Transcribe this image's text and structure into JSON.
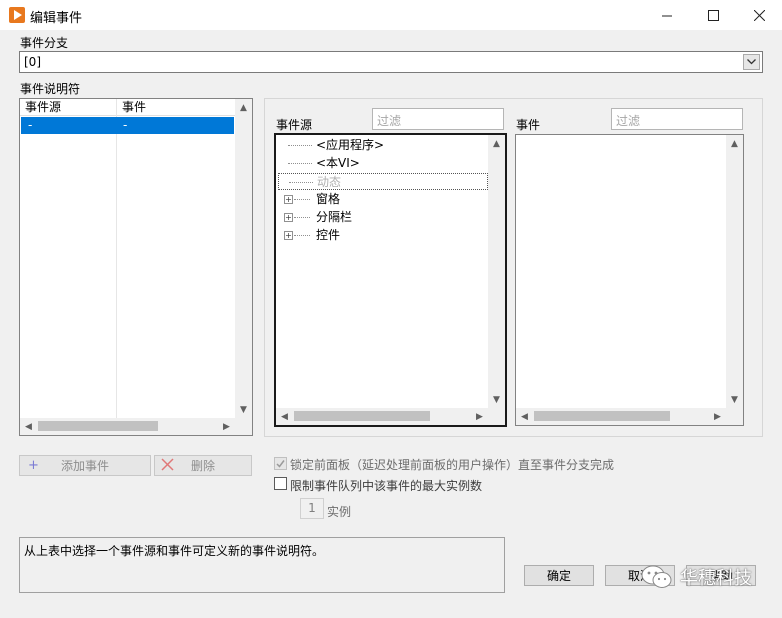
{
  "window": {
    "title": "编辑事件",
    "minimize_icon": "minimize-icon",
    "maximize_icon": "maximize-icon",
    "close_icon": "close-icon"
  },
  "event_case": {
    "label": "事件分支",
    "value": "[0]"
  },
  "specifiers": {
    "label": "事件说明符",
    "columns": [
      "事件源",
      "事件"
    ],
    "rows": [
      {
        "source": "-",
        "event": "-"
      }
    ],
    "add_button": "添加事件",
    "delete_button": "删除"
  },
  "event_sources": {
    "label": "事件源",
    "filter_placeholder": "过滤",
    "items": [
      {
        "label": "<应用程序>",
        "expandable": false,
        "disabled": false
      },
      {
        "label": "<本VI>",
        "expandable": false,
        "disabled": false
      },
      {
        "label": "动态",
        "expandable": false,
        "disabled": true
      },
      {
        "label": "窗格",
        "expandable": true,
        "disabled": false
      },
      {
        "label": "分隔栏",
        "expandable": true,
        "disabled": false
      },
      {
        "label": "控件",
        "expandable": true,
        "disabled": false
      }
    ]
  },
  "events": {
    "label": "事件",
    "filter_placeholder": "过滤"
  },
  "options": {
    "lock_panel": {
      "label": "锁定前面板（延迟处理前面板的用户操作）直至事件分支完成",
      "checked": true,
      "enabled": false
    },
    "limit_queue": {
      "label": "限制事件队列中该事件的最大实例数",
      "checked": false,
      "enabled": true
    },
    "instances_value": "1",
    "instances_label": "实例"
  },
  "description": "从上表中选择一个事件源和事件可定义新的事件说明符。",
  "buttons": {
    "ok": "确定",
    "cancel": "取消",
    "help": "帮助"
  },
  "watermark": "华穗科技",
  "colors": {
    "selection": "#0078d7",
    "app_icon": "#e8781e"
  }
}
